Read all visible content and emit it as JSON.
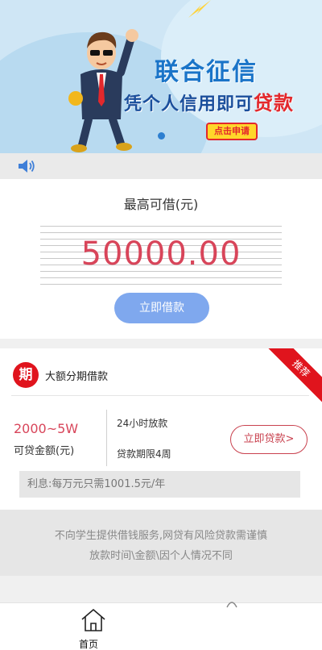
{
  "banner": {
    "title": "联合征信",
    "subtitle_prefix": "凭个人信用即可",
    "subtitle_highlight": "贷款",
    "apply_button": "点击申请"
  },
  "loan": {
    "max_label": "最高可借(元)",
    "amount": "50000.00",
    "borrow_button": "立即借款"
  },
  "product": {
    "ribbon": "推荐",
    "icon_char": "期",
    "name": "大额分期借款",
    "range": "2000~5W",
    "range_label": "可贷金额(元)",
    "feature_1": "24小时放款",
    "feature_2": "贷款期限4周",
    "loan_button": "立即贷款>",
    "interest": "利息:每万元只需1001.5元/年"
  },
  "disclaimer": {
    "line1": "不向学生提供借钱服务,网贷有风险贷款需谨慎",
    "line2": "放款时间\\金额\\因个人情况不同"
  },
  "nav": {
    "home_label": "首页"
  },
  "colors": {
    "accent_red": "#d8455a",
    "button_blue": "#7fa8ee",
    "brand_red": "#e0141d"
  }
}
